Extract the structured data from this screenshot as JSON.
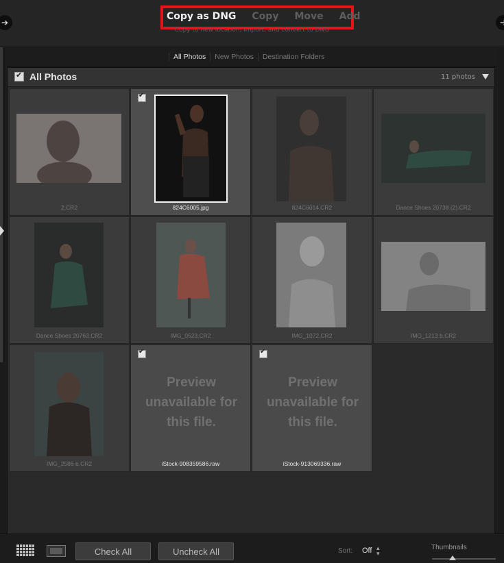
{
  "modes": {
    "copy_as_dng": "Copy as DNG",
    "copy": "Copy",
    "move": "Move",
    "add": "Add",
    "subtitle": "Copy to new location, import, and convert to DNG"
  },
  "tabs": {
    "all_photos": "All Photos",
    "new_photos": "New Photos",
    "destination_folders": "Destination Folders"
  },
  "grid_header": {
    "title": "All Photos",
    "count": "11 photos"
  },
  "photos": [
    {
      "filename": "2.CR2",
      "checked": false
    },
    {
      "filename": "824C6005.jpg",
      "checked": true
    },
    {
      "filename": "824C6014.CR2",
      "checked": false
    },
    {
      "filename": "Dance Shoes 20738 (2).CR2",
      "checked": false
    },
    {
      "filename": "Dance Shoes 20763.CR2",
      "checked": false
    },
    {
      "filename": "IMG_0523.CR2",
      "checked": false
    },
    {
      "filename": "IMG_1072.CR2",
      "checked": false
    },
    {
      "filename": "IMG_1213 b.CR2",
      "checked": false
    },
    {
      "filename": "IMG_2586 b.CR2",
      "checked": false
    },
    {
      "filename": "iStock-908359586.raw",
      "checked": true,
      "preview_message": "Preview unavailable for this file."
    },
    {
      "filename": "iStock-913069336.raw",
      "checked": true,
      "preview_message": "Preview unavailable for this file."
    }
  ],
  "bottom": {
    "check_all": "Check All",
    "uncheck_all": "Uncheck All",
    "sort_label": "Sort:",
    "sort_value": "Off",
    "thumbnails_label": "Thumbnails"
  },
  "colors": {
    "highlight_box": "#e4141b",
    "active_text": "#f0f0f0",
    "inactive_text": "#5e5e5e"
  }
}
